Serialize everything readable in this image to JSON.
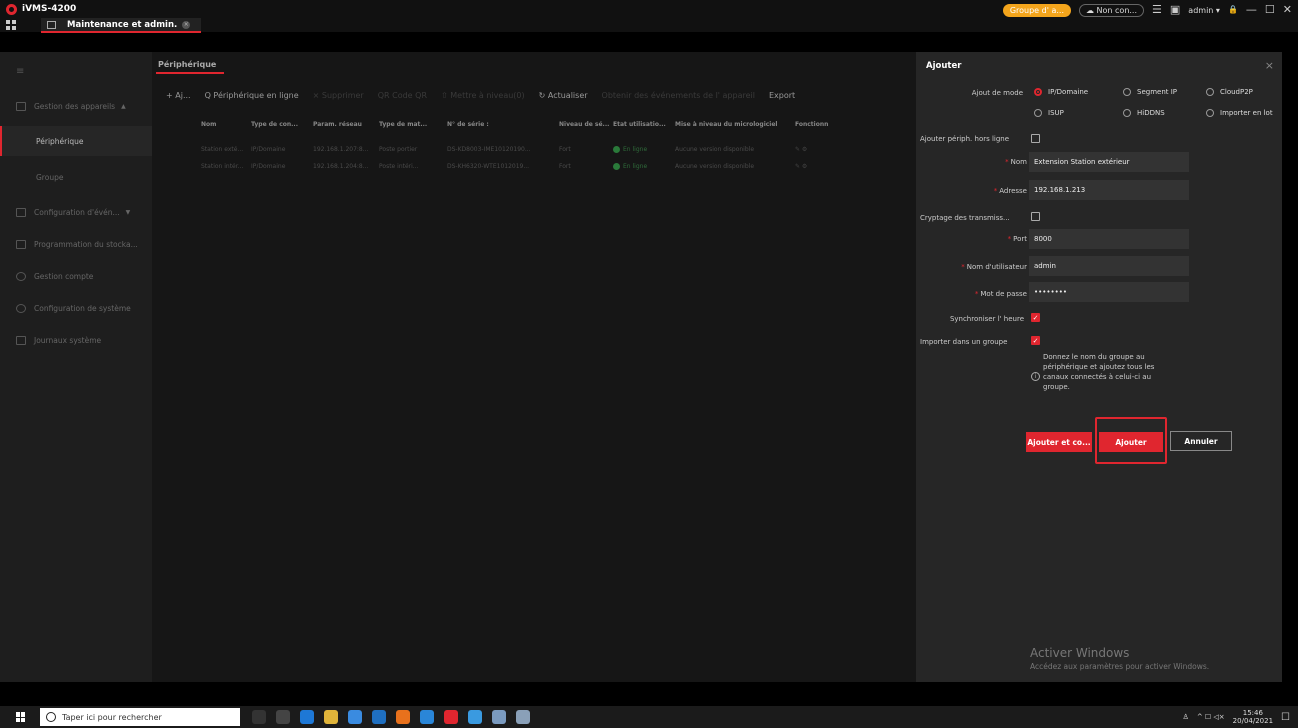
{
  "app": {
    "title": "iVMS-4200"
  },
  "titlebar": {
    "group_badge": "Groupe d' a...",
    "cloud_status": "Non con...",
    "user": "admin",
    "user_chevron": "▾",
    "list_icon": "☰",
    "image_icon": "▣",
    "lock_icon": "🔒",
    "minimize_icon": "—",
    "restore_icon": "☐",
    "close_icon": "✕"
  },
  "tab": {
    "label": "Maintenance et admin.",
    "close": "×"
  },
  "sidebar": {
    "menu_icon": "≡",
    "items": [
      {
        "label": "Gestion des appareils",
        "chevron": "▲"
      },
      {
        "label": "Configuration d'évén...",
        "chevron": "▼"
      },
      {
        "label": "Programmation du stocka..."
      },
      {
        "label": "Gestion compte"
      },
      {
        "label": "Configuration de système"
      },
      {
        "label": "Journaux système"
      }
    ],
    "subitems": [
      {
        "label": "Périphérique"
      },
      {
        "label": "Groupe"
      }
    ]
  },
  "main": {
    "title": "Périphérique",
    "toolbar": {
      "add": "+ Aj...",
      "online": "Q Périphérique en ligne",
      "delete": "× Supprimer",
      "qr": "QR Code QR",
      "upgrade": "⇧ Mettre à niveau(0)",
      "refresh": "↻ Actualiser",
      "events": "Obtenir des événements de l' appareil",
      "export": "Export"
    },
    "table": {
      "headers": [
        "Nom",
        "Type de con...",
        "Param. réseau",
        "Type de mat...",
        "N° de série :",
        "Niveau de sé...",
        "Etat utilisatio...",
        "Mise à niveau du micrologiciel",
        "Fonctionn"
      ],
      "rows": [
        [
          "Station exté...",
          "IP/Domaine",
          "192.168.1.207:8...",
          "Poste portier",
          "DS-KD8003-IME10120190...",
          "Fort",
          "En ligne",
          "Aucune version disponible"
        ],
        [
          "Station intér...",
          "IP/Domaine",
          "192.168.1.204:8...",
          "Poste intéri...",
          "DS-KH6320-WTE1012019...",
          "Fort",
          "En ligne",
          "Aucune version disponible"
        ]
      ]
    }
  },
  "panel": {
    "title": "Ajouter",
    "close": "×",
    "mode_label": "Ajout de mode",
    "modes": [
      "IP/Domaine",
      "Segment IP",
      "CloudP2P",
      "ISUP",
      "HiDDNS",
      "Importer en lot"
    ],
    "offline_label": "Ajouter périph. hors ligne",
    "name_label": "Nom",
    "name_value": "Extension Station extérieur",
    "address_label": "Adresse",
    "address_value": "192.168.1.213",
    "encrypt_label": "Cryptage des transmiss...",
    "port_label": "Port",
    "port_value": "8000",
    "user_label": "Nom d'utilisateur",
    "user_value": "admin",
    "password_label": "Mot de passe",
    "password_value": "••••••••",
    "sync_label": "Synchroniser l'  heure",
    "import_label": "Importer dans un groupe",
    "hint": "Donnez le nom du groupe au périphérique et ajoutez tous les canaux connectés à celui-ci au groupe.",
    "btn_add_continue": "Ajouter et co...",
    "btn_add": "Ajouter",
    "btn_cancel": "Annuler",
    "activate_title": "Activer Windows",
    "activate_sub": "Accédez aux paramètres pour activer Windows."
  },
  "taskbar": {
    "search_placeholder": "Taper ici pour rechercher",
    "time": "15:46",
    "date": "20/04/2021",
    "tray_text": "^ ☐ ◁×"
  },
  "colors": {
    "accent": "#e0262f",
    "badge": "#f4a51c",
    "panel": "#262626"
  }
}
